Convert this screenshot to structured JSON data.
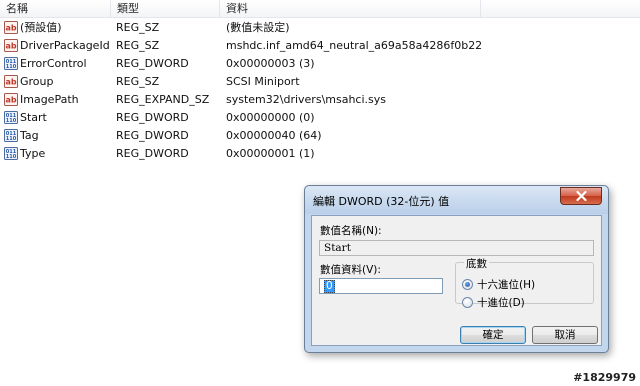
{
  "list": {
    "columns": {
      "name": "名稱",
      "type": "類型",
      "data": "資料"
    },
    "rows": [
      {
        "icon": "string-value-icon",
        "name": "(預設值)",
        "type": "REG_SZ",
        "data": "(數值未設定)"
      },
      {
        "icon": "string-value-icon",
        "name": "DriverPackageId",
        "type": "REG_SZ",
        "data": "mshdc.inf_amd64_neutral_a69a58a4286f0b22"
      },
      {
        "icon": "binary-value-icon",
        "name": "ErrorControl",
        "type": "REG_DWORD",
        "data": "0x00000003 (3)"
      },
      {
        "icon": "string-value-icon",
        "name": "Group",
        "type": "REG_SZ",
        "data": "SCSI Miniport"
      },
      {
        "icon": "string-value-icon",
        "name": "ImagePath",
        "type": "REG_EXPAND_SZ",
        "data": "system32\\drivers\\msahci.sys"
      },
      {
        "icon": "binary-value-icon",
        "name": "Start",
        "type": "REG_DWORD",
        "data": "0x00000000 (0)"
      },
      {
        "icon": "binary-value-icon",
        "name": "Tag",
        "type": "REG_DWORD",
        "data": "0x00000040 (64)"
      },
      {
        "icon": "binary-value-icon",
        "name": "Type",
        "type": "REG_DWORD",
        "data": "0x00000001 (1)"
      }
    ]
  },
  "dialog": {
    "title": "編輯 DWORD (32-位元) 值",
    "value_name_label": "數值名稱(N):",
    "value_name": "Start",
    "value_data_label": "數值資料(V):",
    "value_data": "0",
    "base_label": "底數",
    "base_options": [
      {
        "label": "十六進位(H)",
        "checked": true
      },
      {
        "label": "十進位(D)",
        "checked": false
      }
    ],
    "ok_label": "確定",
    "cancel_label": "取消"
  },
  "watermark": "#1829979",
  "colors": {
    "string_icon": "#c0392b",
    "binary_icon": "#2a5caa",
    "dialog_frame": "#c2d7ee",
    "close_button": "#c8452c"
  }
}
